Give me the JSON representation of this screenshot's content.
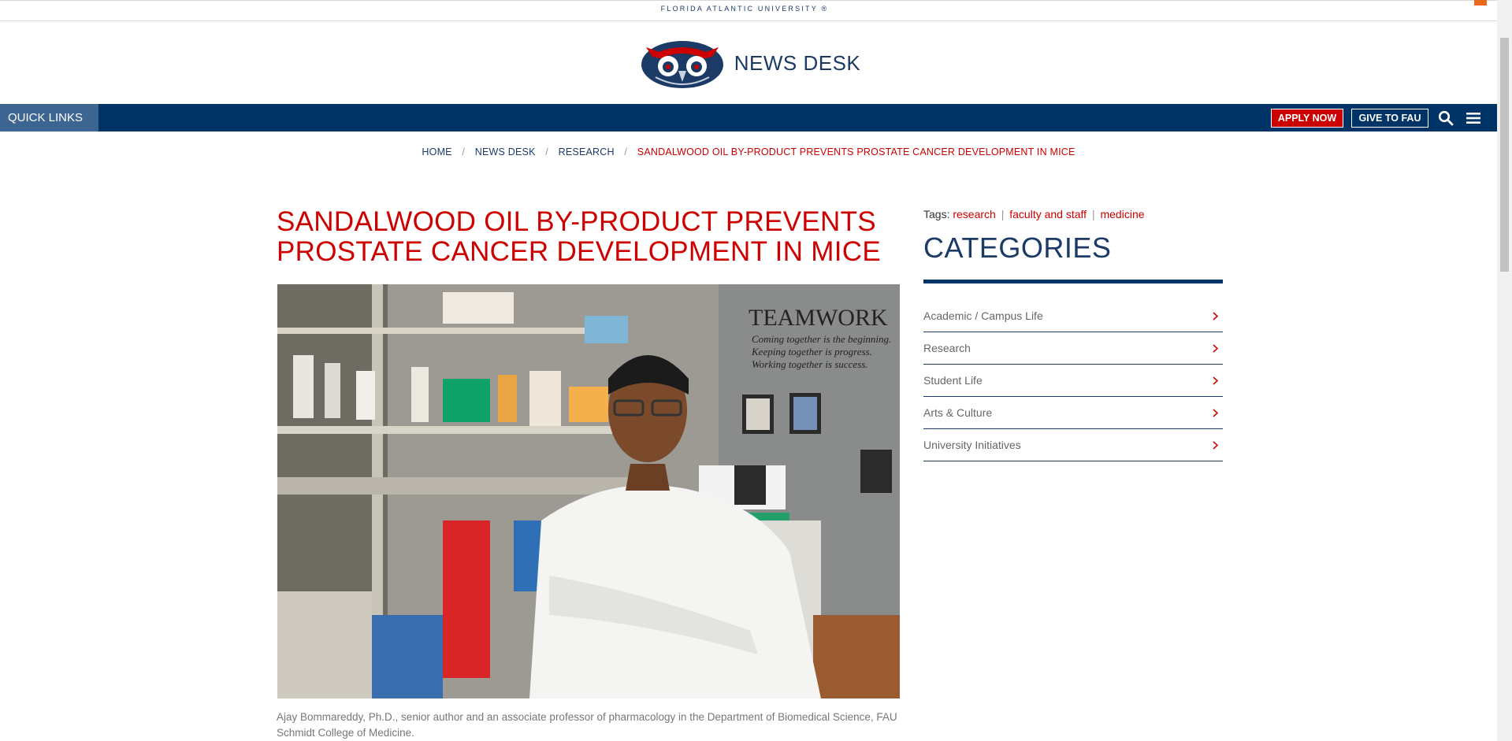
{
  "top_bar": {
    "university": "FLORIDA ATLANTIC UNIVERSITY ®"
  },
  "brand": {
    "title": "NEWS DESK",
    "logo_icon": "owl-logo-icon"
  },
  "nav": {
    "quick_links": "QUICK LINKS",
    "apply": "APPLY NOW",
    "give": "GIVE TO FAU",
    "icons": [
      "search-icon",
      "menu-icon",
      "chevron-down-icon"
    ]
  },
  "breadcrumbs": {
    "items": [
      "HOME",
      "NEWS DESK",
      "RESEARCH"
    ],
    "separator": "/",
    "current": "SANDALWOOD OIL BY-PRODUCT PREVENTS PROSTATE CANCER DEVELOPMENT IN MICE"
  },
  "article": {
    "headline_line1": "SANDALWOOD OIL BY-PRODUCT PREVENTS",
    "headline_line2": "PROSTATE CANCER DEVELOPMENT IN MICE",
    "image_sign": [
      "TEAMWORK",
      "Coming together is the beginning.",
      "Keeping together is progress.",
      "Working together is success."
    ],
    "caption": "Ajay Bommareddy, Ph.D., senior author and an associate professor of pharmacology in the Department of Biomedical Science, FAU Schmidt College of Medicine."
  },
  "sidebar": {
    "tags_label": "Tags:",
    "tags": [
      "research",
      "faculty and staff",
      "medicine"
    ],
    "tag_separator": "|",
    "categories_title": "CATEGORIES",
    "categories": [
      "Academic / Campus Life",
      "Research",
      "Student Life",
      "Arts & Culture",
      "University Initiatives"
    ]
  },
  "colors": {
    "navy": "#003366",
    "red": "#cc0000",
    "quick_links_bg": "#3c6591",
    "accent_orange": "#e86a1a"
  }
}
